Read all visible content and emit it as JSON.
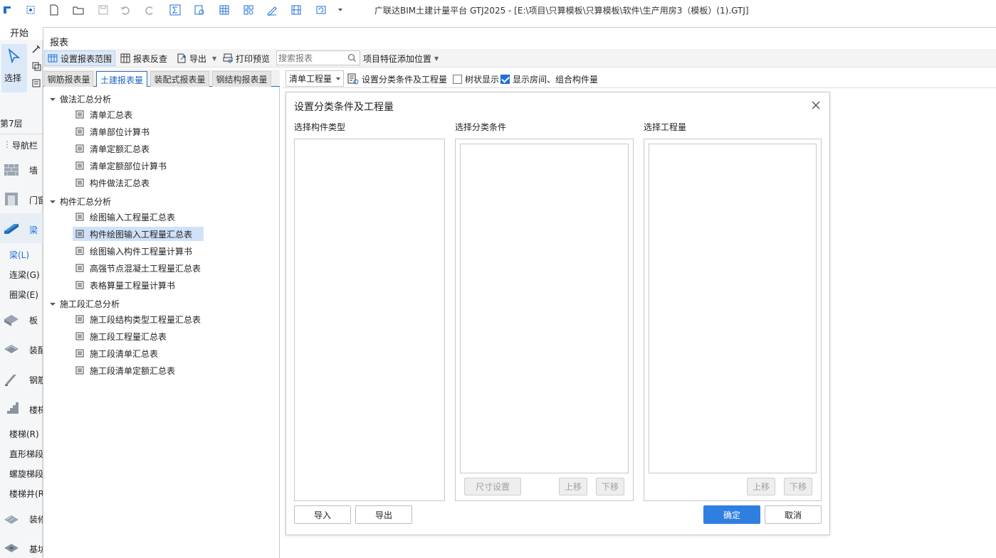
{
  "app": {
    "title": "广联达BIM土建计量平台 GTJ2025 - [E:\\项目\\只算模板\\只算模板\\软件\\生产用房3（模板）(1).GTJ]"
  },
  "ribbon": {
    "start_tab": "开始",
    "select_label": "选择"
  },
  "sidebar": {
    "floor": "第7层",
    "nav": "导航栏",
    "items": [
      {
        "label": "墙"
      },
      {
        "label": "门窗"
      },
      {
        "label": "梁"
      },
      {
        "label": "板"
      },
      {
        "label": "装配"
      },
      {
        "label": "钢筋"
      },
      {
        "label": "楼梯"
      },
      {
        "label": "装修"
      },
      {
        "label": "基坑"
      }
    ],
    "beam_sub": [
      "梁(L)",
      "连梁(G)",
      "圈梁(E)"
    ],
    "stair_sub": [
      "楼梯(R)",
      "直形梯段",
      "螺旋梯段",
      "楼梯井(R)"
    ]
  },
  "report": {
    "title": "报表",
    "toolbar": {
      "set_range": "设置报表范围",
      "reverse_check": "报表反查",
      "export": "导出",
      "print_preview": "打印预览",
      "search_placeholder": "搜索报表",
      "feature_position": "项目特征添加位置"
    },
    "tabs": [
      "钢筋报表量",
      "土建报表量",
      "装配式报表量",
      "钢结构报表量"
    ],
    "active_tab": 1,
    "tree": [
      {
        "group": "做法汇总分析",
        "items": [
          "清单汇总表",
          "清单部位计算书",
          "清单定额汇总表",
          "清单定额部位计算书",
          "构件做法汇总表"
        ]
      },
      {
        "group": "构件汇总分析",
        "items": [
          "绘图输入工程量汇总表",
          "构件绘图输入工程量汇总表",
          "绘图输入构件工程量计算书",
          "高强节点混凝土工程量汇总表",
          "表格算量工程量计算书"
        ]
      },
      {
        "group": "施工段汇总分析",
        "items": [
          "施工段结构类型工程量汇总表",
          "施工段工程量汇总表",
          "施工段清单汇总表",
          "施工段清单定额汇总表"
        ]
      }
    ],
    "selected_item": "构件绘图输入工程量汇总表"
  },
  "right_toolbar": {
    "qty_select": "清单工程量",
    "set_conditions": "设置分类条件及工程量",
    "tree_display": "树状显示",
    "tree_display_checked": false,
    "show_rooms": "显示房间、组合构件量",
    "show_rooms_checked": true
  },
  "dialog": {
    "title": "设置分类条件及工程量",
    "col1_label": "选择构件类型",
    "col2_label": "选择分类条件",
    "col3_label": "选择工程量",
    "size_setting": "尺寸设置",
    "move_up": "上移",
    "move_down": "下移",
    "import": "导入",
    "export": "导出",
    "ok": "确定",
    "cancel": "取消"
  },
  "colors": {
    "accent": "#2f7fe0",
    "selected_bg": "#cfe2f8",
    "active_tab_text": "#1f63c2"
  }
}
